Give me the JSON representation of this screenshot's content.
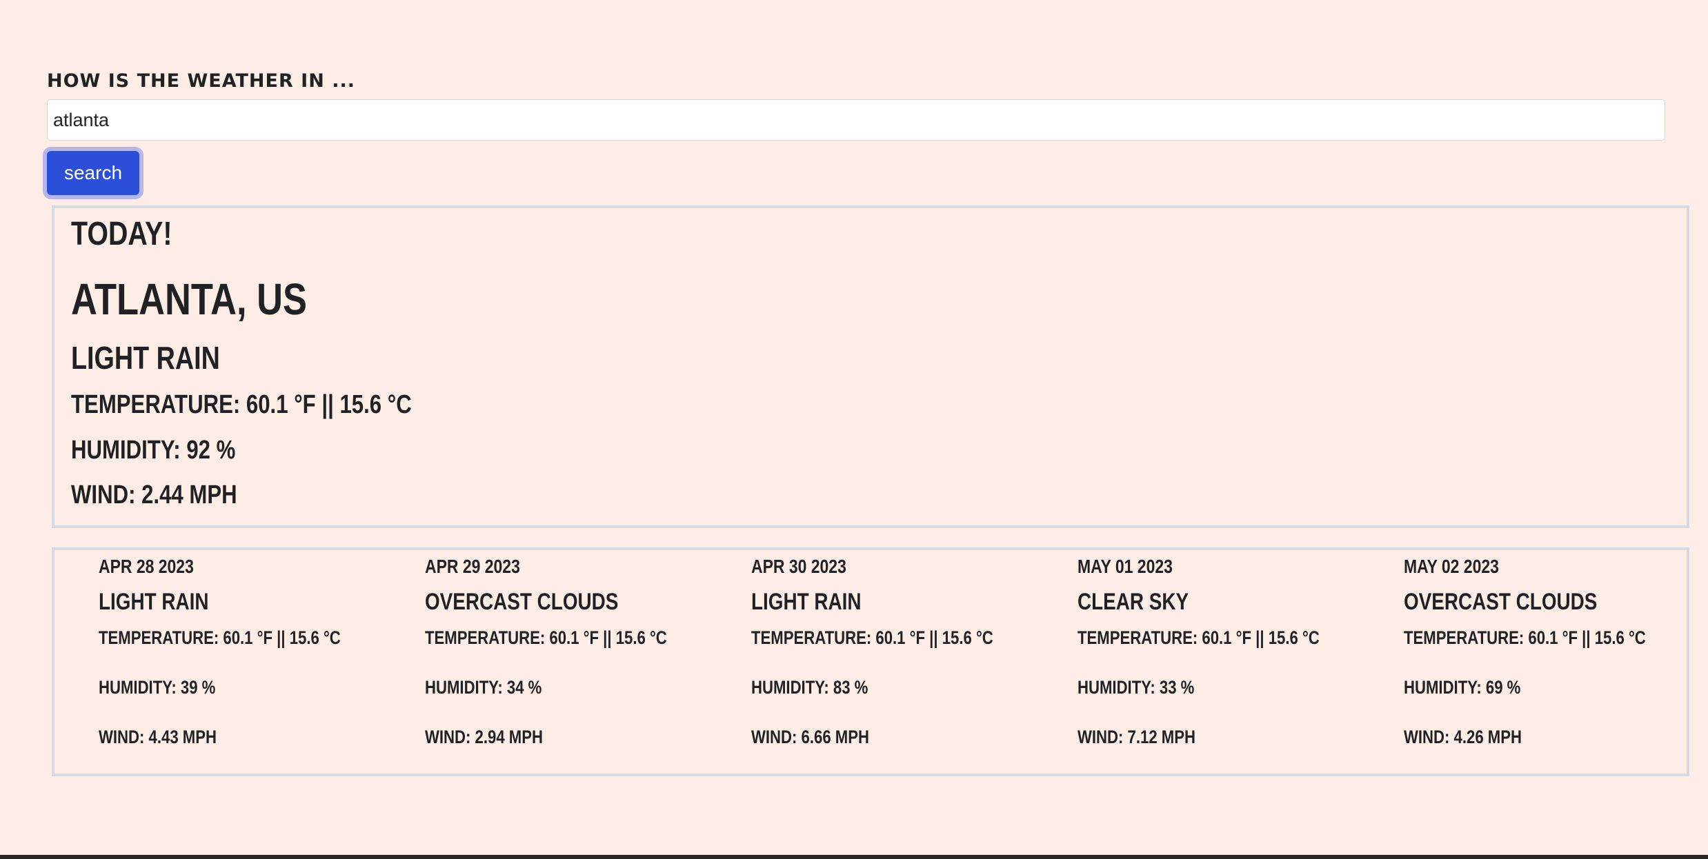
{
  "search": {
    "label": "How is the weather in ...",
    "value": "atlanta",
    "button_label": "search"
  },
  "today": {
    "heading": "Today!",
    "city": "Atlanta, US",
    "condition": "Light rain",
    "temperature": "Temperature: 60.1 °F || 15.6 °C",
    "humidity": "Humidity: 92 %",
    "wind": "Wind: 2.44 MPH"
  },
  "forecast": [
    {
      "date": "Apr 28 2023",
      "condition": "Light rain",
      "temperature": "Temperature: 60.1 °F || 15.6 °C",
      "humidity": "Humidity: 39 %",
      "wind": "Wind: 4.43 MPH"
    },
    {
      "date": "Apr 29 2023",
      "condition": "Overcast clouds",
      "temperature": "Temperature: 60.1 °F || 15.6 °C",
      "humidity": "Humidity: 34 %",
      "wind": "Wind: 2.94 MPH"
    },
    {
      "date": "Apr 30 2023",
      "condition": "Light rain",
      "temperature": "Temperature: 60.1 °F || 15.6 °C",
      "humidity": "Humidity: 83 %",
      "wind": "Wind: 6.66 MPH"
    },
    {
      "date": "May 01 2023",
      "condition": "Clear sky",
      "temperature": "Temperature: 60.1 °F || 15.6 °C",
      "humidity": "Humidity: 33 %",
      "wind": "Wind: 7.12 MPH"
    },
    {
      "date": "May 02 2023",
      "condition": "Overcast clouds",
      "temperature": "Temperature: 60.1 °F || 15.6 °C",
      "humidity": "Humidity: 69 %",
      "wind": "Wind: 4.26 MPH"
    }
  ],
  "colors": {
    "background": "#feece6",
    "button": "#2c4fd9",
    "card_border": "#d5dbe0",
    "text": "#1f2123"
  }
}
